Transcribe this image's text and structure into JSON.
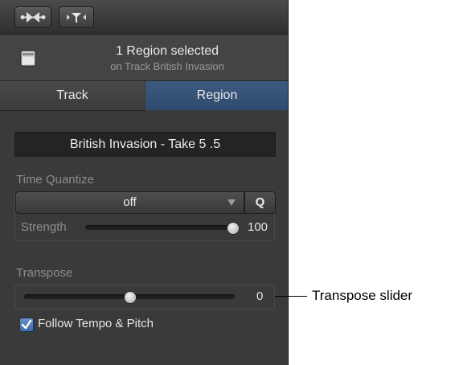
{
  "toolbar": {
    "buttons": [
      {
        "name": "smart-controls-toggle",
        "icon": "bowtie-flex-icon"
      },
      {
        "name": "midi-filter-toggle",
        "icon": "filter-funnel-icon"
      }
    ]
  },
  "header": {
    "title": "1 Region selected",
    "subtitle": "on Track British Invasion",
    "icon": "region-icon"
  },
  "tabs": [
    {
      "label": "Track",
      "active": false
    },
    {
      "label": "Region",
      "active": true
    }
  ],
  "region_name": "British Invasion - Take 5 .5",
  "time_quantize": {
    "label": "Time Quantize",
    "value": "off",
    "q_label": "Q",
    "strength_label": "Strength",
    "strength_value": "100",
    "strength_fraction": 1.0
  },
  "transpose": {
    "label": "Transpose",
    "value": "0",
    "fraction": 0.5
  },
  "follow_tempo": {
    "label": "Follow Tempo & Pitch",
    "checked": true
  },
  "callout": {
    "text": "Transpose slider"
  },
  "colors": {
    "panel_bg": "#3a3a3a",
    "active_tab": "#2f4a6e",
    "checkbox_blue": "#3e6aa6"
  }
}
